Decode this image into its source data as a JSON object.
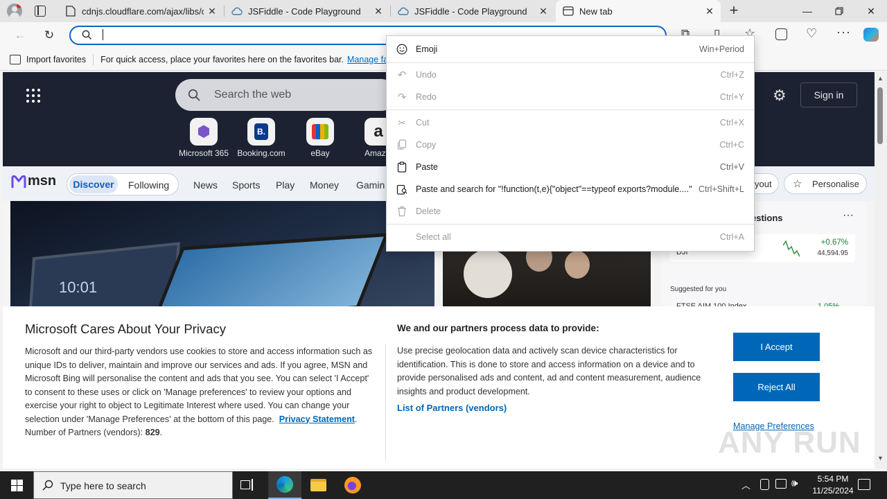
{
  "browser": {
    "tabs": [
      {
        "title": "cdnjs.cloudflare.com/ajax/libs/c",
        "icon": "page-icon"
      },
      {
        "title": "JSFiddle - Code Playground",
        "icon": "jsfiddle-icon"
      },
      {
        "title": "JSFiddle - Code Playground",
        "icon": "jsfiddle-icon"
      },
      {
        "title": "New tab",
        "icon": "newtab-icon"
      }
    ],
    "address_value": "",
    "favorites_bar": {
      "import_label": "Import favorites",
      "hint": "For quick access, place your favorites here on the favorites bar.",
      "manage_link": "Manage favorit"
    }
  },
  "msn": {
    "search_placeholder": "Search the web",
    "sign_in": "Sign in",
    "quick_links": [
      {
        "label": "Microsoft 365",
        "glyph": "⬢",
        "color": "#7b54c7"
      },
      {
        "label": "Booking.com",
        "glyph": "B.",
        "color": "#0a3a8a"
      },
      {
        "label": "eBay",
        "glyph": "▤",
        "color": "#2a2a2a"
      },
      {
        "label": "Amaz",
        "glyph": "a",
        "color": "#222222"
      }
    ],
    "logo": "msn",
    "nav": [
      "Discover",
      "Following",
      "News",
      "Sports",
      "Play",
      "Money",
      "Gamin"
    ],
    "layout_label": "yout",
    "personalise_label": "Personalise",
    "watchlist_title": "estions",
    "stock": {
      "symbol": "DJI",
      "change": "+0.67%",
      "value": "44,594.95"
    },
    "suggested": "Suggested for you",
    "suggested_item": {
      "name": "FTSE AIM 100 Index",
      "change": "1.05%"
    },
    "tablet_time": "10:01"
  },
  "context_menu": {
    "items": [
      {
        "label": "Emoji",
        "shortcut": "Win+Period",
        "icon": "emoji-icon",
        "enabled": true
      },
      {
        "label": "Undo",
        "shortcut": "Ctrl+Z",
        "icon": "undo-icon",
        "enabled": false
      },
      {
        "label": "Redo",
        "shortcut": "Ctrl+Y",
        "icon": "redo-icon",
        "enabled": false
      },
      {
        "label": "Cut",
        "shortcut": "Ctrl+X",
        "icon": "cut-icon",
        "enabled": false
      },
      {
        "label": "Copy",
        "shortcut": "Ctrl+C",
        "icon": "copy-icon",
        "enabled": false
      },
      {
        "label": "Paste",
        "shortcut": "Ctrl+V",
        "icon": "paste-icon",
        "enabled": true
      },
      {
        "label": "Paste and search for \"!function(t,e){\"object\"==typeof exports?module....\"",
        "shortcut": "Ctrl+Shift+L",
        "icon": "paste-search-icon",
        "enabled": true
      },
      {
        "label": "Delete",
        "shortcut": "",
        "icon": "delete-icon",
        "enabled": false
      },
      {
        "label": "Select all",
        "shortcut": "Ctrl+A",
        "icon": "",
        "enabled": false
      }
    ]
  },
  "privacy": {
    "title": "Microsoft Cares About Your Privacy",
    "body": "Microsoft and our third-party vendors use cookies to store and access information such as unique IDs to deliver, maintain and improve our services and ads. If you agree, MSN and Microsoft Bing will personalise the content and ads that you see. You can select 'I Accept' to consent to these uses or click on 'Manage preferences' to review your options and exercise your right to object to Legitimate Interest where used.  You can change your selection under 'Manage Preferences' at the bottom of this page.",
    "privacy_link": "Privacy Statement",
    "partners_label": "Number of Partners (vendors):",
    "partners_count": "829",
    "process_title": "We and our partners process data to provide:",
    "process_body": "Use precise geolocation data and actively scan device characteristics for identification. This is done to store and access information on a device and to provide personalised ads and content, ad and content measurement, audience insights and product development.",
    "partners_link": "List of Partners (vendors)",
    "accept": "I Accept",
    "reject": "Reject All",
    "manage": "Manage Preferences"
  },
  "watermark": "ANY RUN",
  "taskbar": {
    "search_placeholder": "Type here to search",
    "time": "5:54 PM",
    "date": "11/25/2024"
  },
  "colors": {
    "accent": "#0a66c2",
    "button_blue": "#0067b8",
    "link_blue": "#0067b8"
  }
}
